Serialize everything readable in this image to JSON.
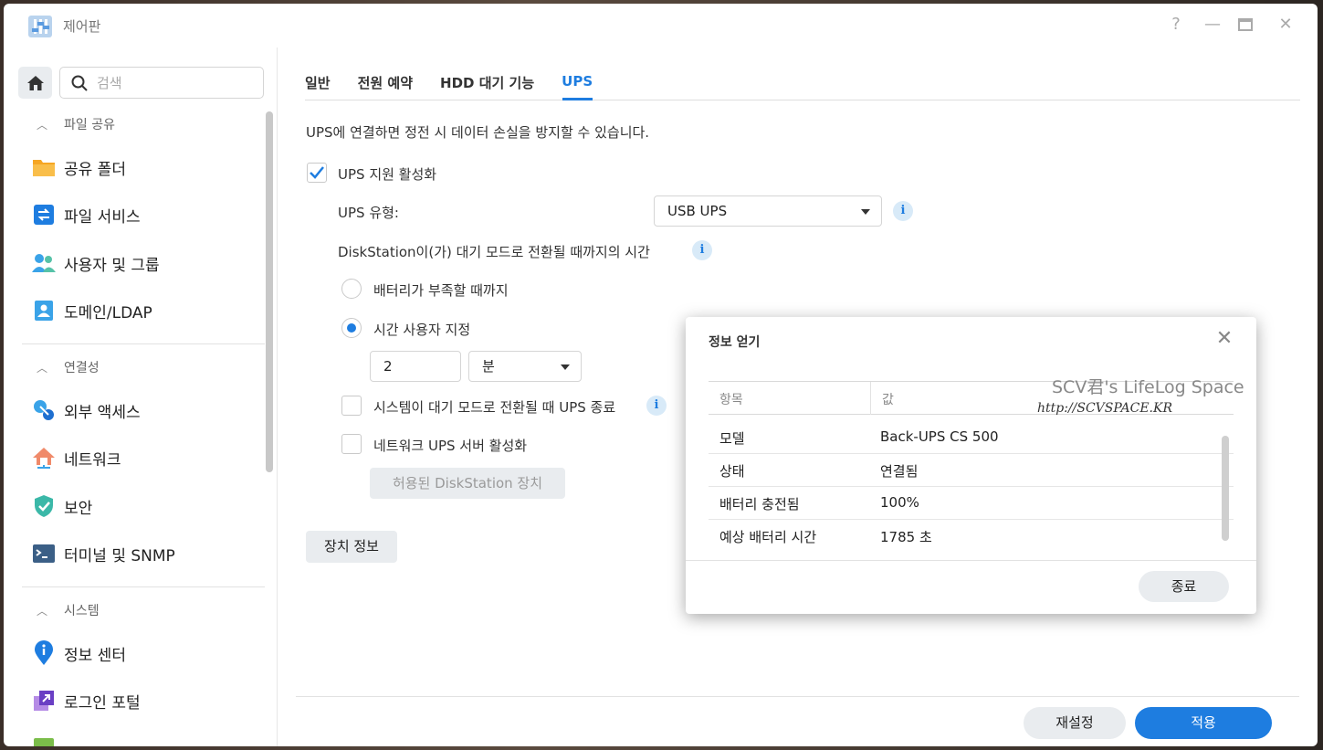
{
  "window": {
    "title": "제어판"
  },
  "sidebar": {
    "search_placeholder": "검색",
    "sections": [
      {
        "label": "파일 공유",
        "items": [
          {
            "label": "공유 폴더",
            "icon": "folder-icon"
          },
          {
            "label": "파일 서비스",
            "icon": "file-services-icon"
          },
          {
            "label": "사용자 및 그룹",
            "icon": "users-icon"
          },
          {
            "label": "도메인/LDAP",
            "icon": "domain-icon"
          }
        ]
      },
      {
        "label": "연결성",
        "items": [
          {
            "label": "외부 액세스",
            "icon": "external-access-icon"
          },
          {
            "label": "네트워크",
            "icon": "network-icon"
          },
          {
            "label": "보안",
            "icon": "shield-icon"
          },
          {
            "label": "터미널 및 SNMP",
            "icon": "terminal-icon"
          }
        ]
      },
      {
        "label": "시스템",
        "items": [
          {
            "label": "정보 센터",
            "icon": "info-center-icon"
          },
          {
            "label": "로그인 포털",
            "icon": "login-portal-icon"
          }
        ]
      }
    ]
  },
  "tabs": [
    {
      "label": "일반",
      "active": false
    },
    {
      "label": "전원 예약",
      "active": false
    },
    {
      "label": "HDD 대기 기능",
      "active": false
    },
    {
      "label": "UPS",
      "active": true
    }
  ],
  "ups": {
    "description": "UPS에 연결하면 정전 시 데이터 손실을 방지할 수 있습니다.",
    "enable_label": "UPS 지원 활성화",
    "enable_checked": true,
    "type_label": "UPS 유형:",
    "type_value": "USB UPS",
    "standby_label": "DiskStation이(가) 대기 모드로 전환될 때까지의 시간",
    "radio_battery_low": "배터리가 부족할 때까지",
    "radio_custom": "시간 사용자 지정",
    "custom_selected": true,
    "time_value": "2",
    "time_unit": "분",
    "shutdown_label": "시스템이 대기 모드로 전환될 때 UPS 종료",
    "shutdown_checked": false,
    "network_server_label": "네트워크 UPS 서버 활성화",
    "network_server_checked": false,
    "allowed_devices_button": "허용된 DiskStation 장치",
    "device_info_button": "장치 정보"
  },
  "footer": {
    "reset_label": "재설정",
    "apply_label": "적용"
  },
  "colors": {
    "accent": "#1e7de0",
    "apply_bg": "#1e7de0",
    "reset_bg": "#e9ecef"
  },
  "dialog": {
    "title": "정보 얻기",
    "columns": [
      "항목",
      "값"
    ],
    "rows": [
      {
        "key": "모델",
        "value": "Back-UPS CS 500"
      },
      {
        "key": "상태",
        "value": "연결됨"
      },
      {
        "key": "배터리 충전됨",
        "value": "100%"
      },
      {
        "key": "예상 배터리 시간",
        "value": "1785 초"
      }
    ],
    "close_button": "종료"
  },
  "watermark": {
    "line1": "SCV君's LifeLog Space",
    "line2": "http://SCVSPACE.KR"
  }
}
